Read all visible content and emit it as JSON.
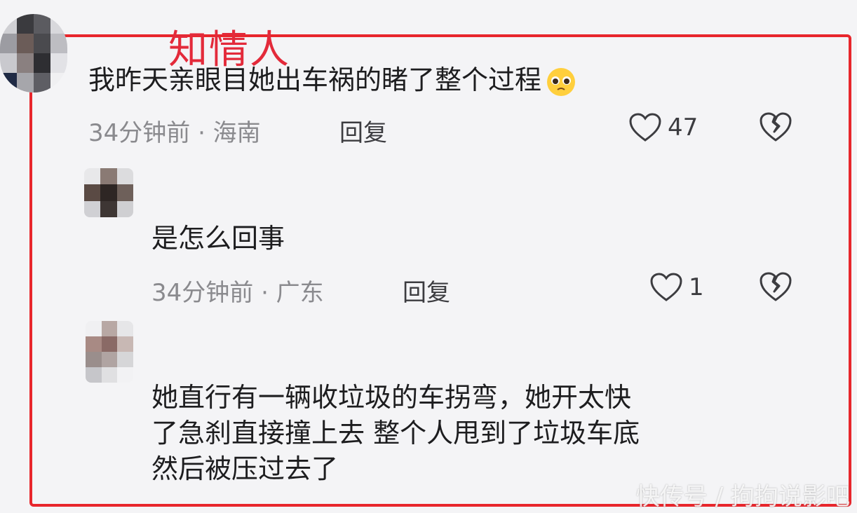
{
  "annotation": "知情人",
  "comments": [
    {
      "text": "我昨天亲眼目她出车祸的睹了整个过程",
      "meta": "34分钟前 · 海南",
      "reply": "回复",
      "likes": "47"
    },
    {
      "text": "是怎么回事",
      "meta": "34分钟前 · 广东",
      "reply": "回复",
      "likes": "1"
    },
    {
      "lines": [
        "她直行有一辆收垃圾的车拐弯，她开太快",
        "了急刹直接撞上去 整个人甩到了垃圾车底",
        "然后被压过去了"
      ]
    }
  ],
  "watermark": "快传号 / 拘拘说影吧",
  "colors": {
    "frame": "#e8262c",
    "annotation": "#e32a3a",
    "meta": "#8a8a8e"
  },
  "icons": [
    "heart-outline-icon",
    "broken-heart-icon",
    "pleading-face-emoji"
  ]
}
